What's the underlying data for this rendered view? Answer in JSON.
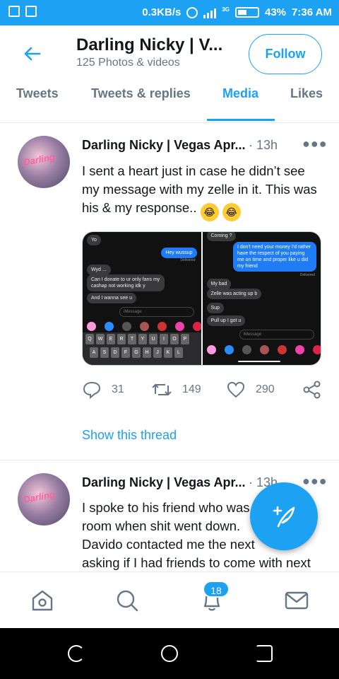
{
  "status_bar": {
    "net_speed": "0.3KB/s",
    "network_type": "3G",
    "battery": "43%",
    "time": "7:36 AM"
  },
  "header": {
    "title": "Darling Nicky | V...",
    "subtitle": "125 Photos & videos",
    "follow_label": "Follow"
  },
  "tabs": [
    {
      "label": "Tweets"
    },
    {
      "label": "Tweets & replies"
    },
    {
      "label": "Media"
    },
    {
      "label": "Likes"
    }
  ],
  "tweets": [
    {
      "avatar_text": "Darling",
      "name": "Darling Nicky | Vegas Apr...",
      "time": "· 13h",
      "text": "I sent a heart just in case he didn’t see my message with my zelle in it. This was his & my response..",
      "emoji": [
        "😂",
        "😂"
      ],
      "replies": "31",
      "retweets": "149",
      "likes": "290",
      "show_thread": "Show this thread",
      "media": {
        "left": {
          "bubbles_in": [
            "Yo",
            "Wyd ...",
            "Can I donate to ur only fans my cashap not working idk y",
            "And I wanna see u"
          ],
          "bubbles_out": [
            "Hey wussup"
          ],
          "delivered": "Delivered",
          "input_placeholder": "iMessage",
          "keyboard_row1": [
            "Q",
            "W",
            "E",
            "R",
            "T",
            "Y",
            "U",
            "I",
            "O",
            "P"
          ],
          "keyboard_row2": [
            "A",
            "S",
            "D",
            "F",
            "G",
            "H",
            "J",
            "K",
            "L"
          ]
        },
        "right": {
          "bubbles_in": [
            "Coming ?",
            "My bad",
            "Zelle was acting up b",
            "Sup",
            "Pull up I got u"
          ],
          "bubbles_out": [
            "I don't need your money I'd rather have the respect of you paying me on time and proper like u did my friend"
          ],
          "delivered": "Delivered",
          "input_placeholder": "iMessage"
        }
      }
    },
    {
      "avatar_text": "Darling",
      "name": "Darling Nicky | Vegas Apr...",
      "time": "· 13h",
      "text_lines": [
        "I spoke to his friend who was",
        "room when shit went down.",
        "Davido contacted me the next",
        "asking if I had friends to come with next"
      ]
    }
  ],
  "bottom_nav": {
    "notifications_badge": "18"
  },
  "colors": {
    "accent": "#1da1f2",
    "secondary_text": "#657786",
    "divider": "#e6ecf0"
  }
}
